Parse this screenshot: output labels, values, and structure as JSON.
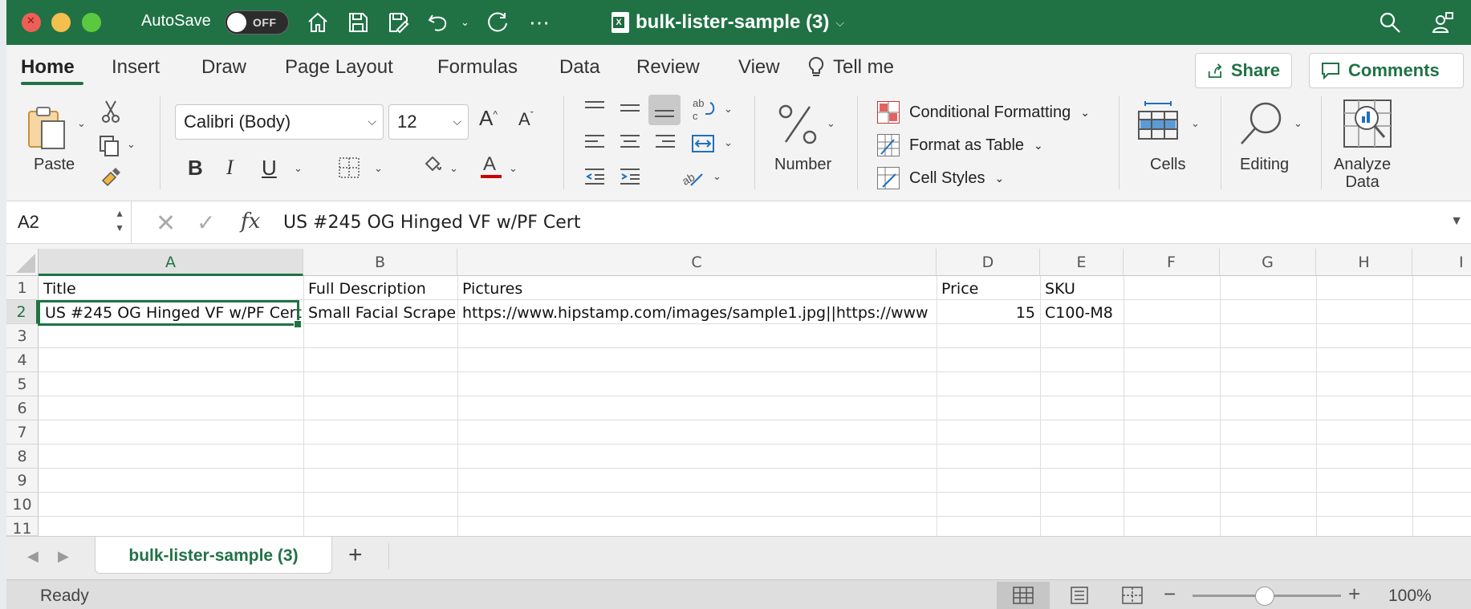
{
  "title_bar": {
    "autosave_label": "AutoSave",
    "autosave_state": "OFF",
    "document_title": "bulk-lister-sample (3)"
  },
  "ribbon_tabs": [
    "Home",
    "Insert",
    "Draw",
    "Page Layout",
    "Formulas",
    "Data",
    "Review",
    "View"
  ],
  "tell_me": "Tell me",
  "share_label": "Share",
  "comments_label": "Comments",
  "ribbon": {
    "paste_label": "Paste",
    "font_name": "Calibri (Body)",
    "font_size": "12",
    "number_label": "Number",
    "conditional_formatting": "Conditional Formatting",
    "format_as_table": "Format as Table",
    "cell_styles": "Cell Styles",
    "cells_label": "Cells",
    "editing_label": "Editing",
    "analyze_data_line1": "Analyze",
    "analyze_data_line2": "Data"
  },
  "formula_bar": {
    "name_box": "A2",
    "content": "US #245 OG Hinged VF w/PF Cert"
  },
  "columns": [
    "A",
    "B",
    "C",
    "D",
    "E",
    "F",
    "G",
    "H",
    "I"
  ],
  "rows": [
    "1",
    "2",
    "3",
    "4",
    "5",
    "6",
    "7",
    "8",
    "9",
    "10",
    "11"
  ],
  "cells": {
    "A1": "Title",
    "B1": "Full Description",
    "C1": "Pictures",
    "D1": "Price",
    "E1": "SKU",
    "A2": "US #245 OG Hinged VF w/PF Cert",
    "B2": "Small Facial Scrape",
    "C2": "https://www.hipstamp.com/images/sample1.jpg||https://www",
    "D2": "15",
    "E2": "C100-M8"
  },
  "sheet_tab": "bulk-lister-sample (3)",
  "status": {
    "text": "Ready",
    "zoom": "100%"
  },
  "colors": {
    "accent": "#207245",
    "tl_red": "#ec5f57",
    "tl_yellow": "#f4bf4f",
    "tl_green": "#5cc840"
  }
}
